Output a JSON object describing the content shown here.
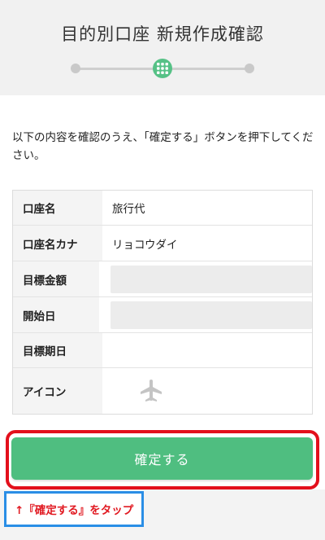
{
  "header": {
    "title": "目的別口座 新規作成確認"
  },
  "instruction": "以下の内容を確認のうえ、「確定する」ボタンを押下してください。",
  "table": {
    "rows": [
      {
        "label": "口座名",
        "value": "旅行代"
      },
      {
        "label": "口座名カナ",
        "value": "リョコウダイ"
      },
      {
        "label": "目標金額",
        "value": ""
      },
      {
        "label": "開始日",
        "value": ""
      },
      {
        "label": "目標期日",
        "value": ""
      },
      {
        "label": "アイコン",
        "icon": "airplane-icon"
      }
    ]
  },
  "confirm_button": {
    "label": "確定する"
  },
  "annotation": {
    "text": "↑『確定する』をタップ"
  },
  "colors": {
    "accent_green": "#4fbe80",
    "highlight_red": "#e3101c",
    "highlight_blue": "#2a8ee6",
    "annotation_text_red": "#e11a22"
  }
}
